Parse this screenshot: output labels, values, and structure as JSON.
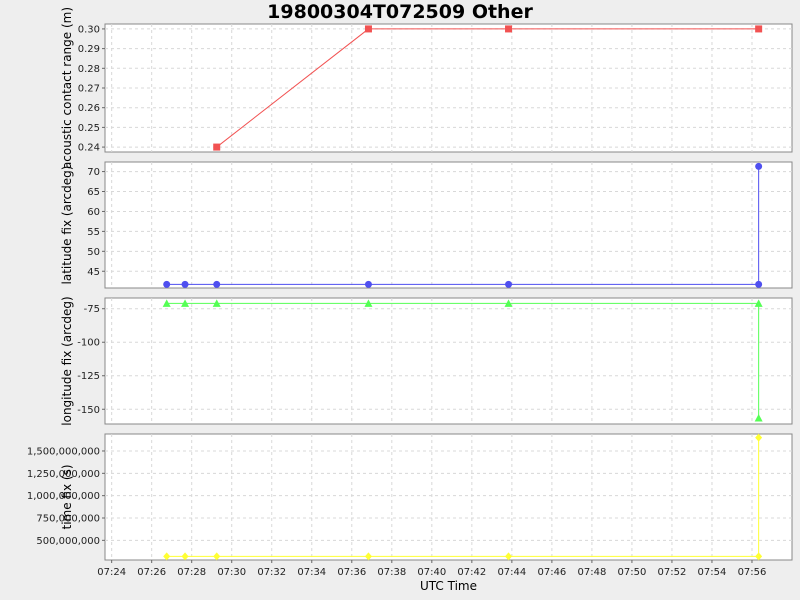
{
  "chart_data": {
    "type": "line",
    "title": "19800304T072509 Other",
    "xlabel": "UTC Time",
    "x_ticks": [
      "07:24",
      "07:26",
      "07:28",
      "07:30",
      "07:32",
      "07:34",
      "07:36",
      "07:38",
      "07:40",
      "07:42",
      "07:44",
      "07:46",
      "07:48",
      "07:50",
      "07:52",
      "07:54",
      "07:56"
    ],
    "x_range": [
      "07:23:40",
      "07:58:00"
    ],
    "grid": true,
    "panels": [
      {
        "ylabel": "acoustic contact range (m)",
        "color": "#f25252",
        "marker": "square",
        "ylim": [
          0.2375,
          0.3025
        ],
        "y_ticks": [
          0.24,
          0.25,
          0.26,
          0.27,
          0.28,
          0.29,
          0.3
        ],
        "y_tick_labels": [
          "0.24",
          "0.25",
          "0.26",
          "0.27",
          "0.28",
          "0.29",
          "0.30"
        ],
        "points": [
          {
            "x": "07:29:15",
            "y": 0.24
          },
          {
            "x": "07:36:50",
            "y": 0.3
          },
          {
            "x": "07:43:50",
            "y": 0.3
          },
          {
            "x": "07:56:20",
            "y": 0.3
          }
        ]
      },
      {
        "ylabel": "latitude fix (arcdeg)",
        "color": "#4f4ff0",
        "marker": "circle",
        "ylim": [
          40.8,
          72.4
        ],
        "y_ticks": [
          45,
          50,
          55,
          60,
          65,
          70
        ],
        "y_tick_labels": [
          "45",
          "50",
          "55",
          "60",
          "65",
          "70"
        ],
        "points": [
          {
            "x": "07:26:45",
            "y": 41.7
          },
          {
            "x": "07:27:40",
            "y": 41.7
          },
          {
            "x": "07:29:15",
            "y": 41.7
          },
          {
            "x": "07:36:50",
            "y": 41.7
          },
          {
            "x": "07:43:50",
            "y": 41.7
          },
          {
            "x": "07:56:20",
            "y": 41.7
          },
          {
            "x": "07:56:20",
            "y": 71.3
          }
        ]
      },
      {
        "ylabel": "longitude fix (arcdeg)",
        "color": "#55ff55",
        "marker": "triangle",
        "ylim": [
          -161,
          -67
        ],
        "y_ticks": [
          -150,
          -125,
          -100,
          -75
        ],
        "y_tick_labels": [
          "-150",
          "-125",
          "-100",
          "-75"
        ],
        "points": [
          {
            "x": "07:26:45",
            "y": -71
          },
          {
            "x": "07:27:40",
            "y": -71
          },
          {
            "x": "07:29:15",
            "y": -71
          },
          {
            "x": "07:36:50",
            "y": -71
          },
          {
            "x": "07:43:50",
            "y": -71
          },
          {
            "x": "07:56:20",
            "y": -71
          },
          {
            "x": "07:56:20",
            "y": -156.5
          }
        ]
      },
      {
        "ylabel": "time fix (s)",
        "color": "#ffff33",
        "marker": "diamond",
        "ylim": [
          280000000,
          1690000000
        ],
        "y_ticks": [
          500000000,
          750000000,
          1000000000,
          1250000000,
          1500000000
        ],
        "y_tick_labels": [
          "500,000,000",
          "750,000,000",
          "1,000,000,000",
          "1,250,000,000",
          "1,500,000,000"
        ],
        "points": [
          {
            "x": "07:26:45",
            "y": 320000000
          },
          {
            "x": "07:27:40",
            "y": 320000000
          },
          {
            "x": "07:29:15",
            "y": 320000000
          },
          {
            "x": "07:36:50",
            "y": 320000000
          },
          {
            "x": "07:43:50",
            "y": 320000000
          },
          {
            "x": "07:56:20",
            "y": 320000000
          },
          {
            "x": "07:56:20",
            "y": 1650000000
          }
        ]
      }
    ]
  }
}
